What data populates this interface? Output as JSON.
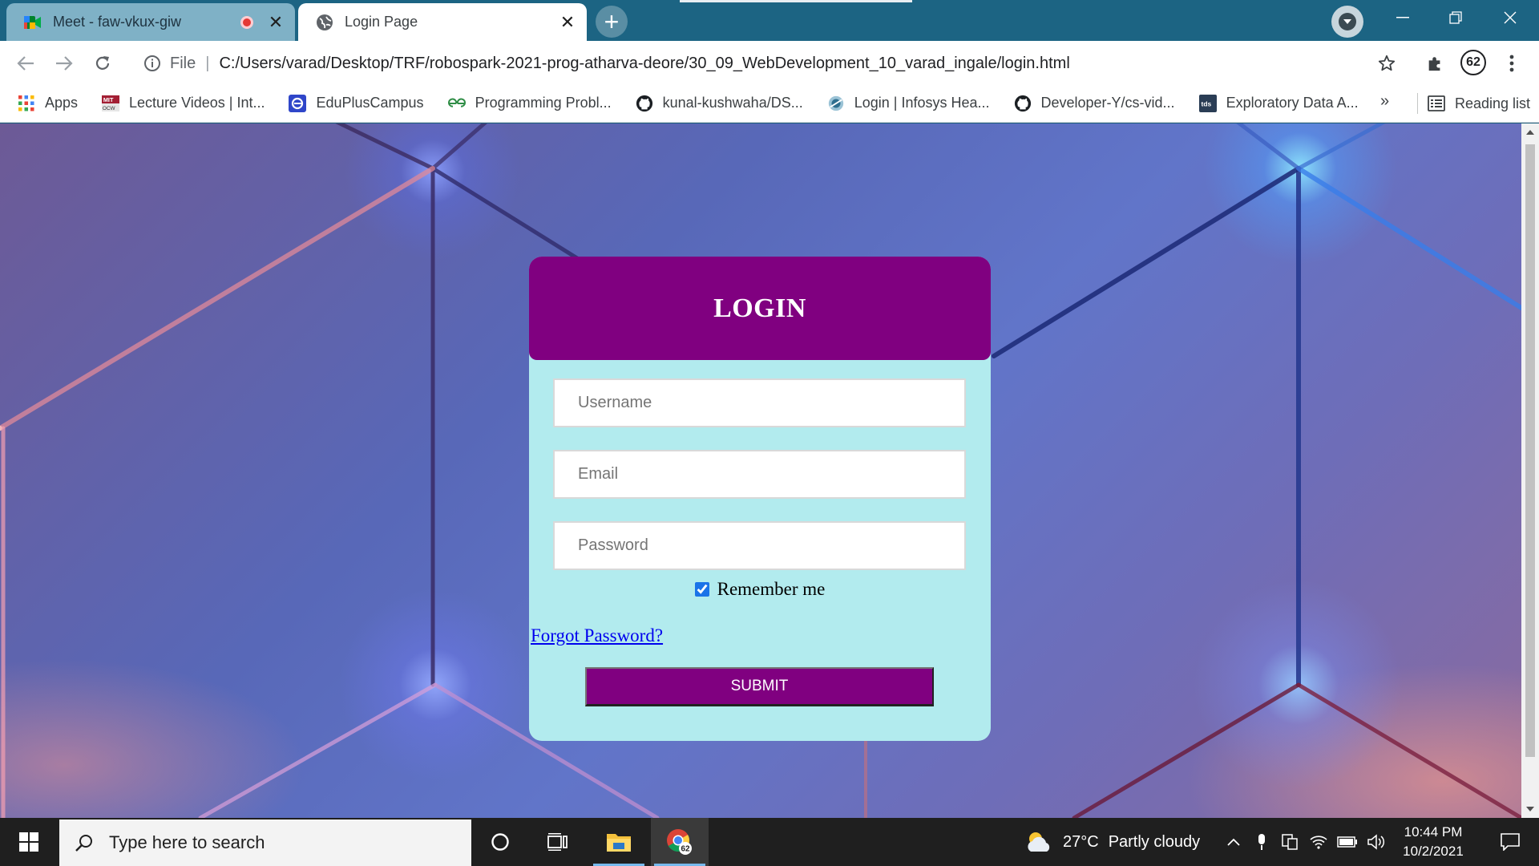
{
  "browser": {
    "tabs": [
      {
        "title": "Meet - faw-vkux-giw",
        "recording": true
      },
      {
        "title": "Login Page"
      }
    ],
    "address": {
      "scheme_label": "File",
      "url": "C:/Users/varad/Desktop/TRF/robospark-2021-prog-atharva-deore/30_09_WebDevelopment_10_varad_ingale/login.html"
    },
    "extension_badge": "62",
    "bookmarks": [
      {
        "label": "Apps",
        "icon": "apps-grid-icon"
      },
      {
        "label": "Lecture Videos | Int...",
        "icon": "mit-ocw-icon"
      },
      {
        "label": "EduPlusCampus",
        "icon": "eduplus-icon"
      },
      {
        "label": "Programming Probl...",
        "icon": "geeksforgeeks-icon"
      },
      {
        "label": "kunal-kushwaha/DS...",
        "icon": "github-icon"
      },
      {
        "label": "Login | Infosys Hea...",
        "icon": "infosys-icon"
      },
      {
        "label": "Developer-Y/cs-vid...",
        "icon": "github-icon"
      },
      {
        "label": "Exploratory Data A...",
        "icon": "tds-icon"
      }
    ],
    "bookmarks_overflow": "»",
    "reading_list": "Reading list"
  },
  "page": {
    "header": "LOGIN",
    "username_placeholder": "Username",
    "email_placeholder": "Email",
    "password_placeholder": "Password",
    "remember_label": "Remember me",
    "remember_checked": true,
    "forgot_link": "Forgot Password?",
    "submit_label": "SUBMIT",
    "colors": {
      "header": "#800080",
      "card": "#b2ebee",
      "button": "#800080"
    }
  },
  "taskbar": {
    "search_placeholder": "Type here to search",
    "weather": {
      "temp": "27°C",
      "condition": "Partly cloudy"
    },
    "time": "10:44 PM",
    "date": "10/2/2021",
    "chrome_badge": "62"
  }
}
